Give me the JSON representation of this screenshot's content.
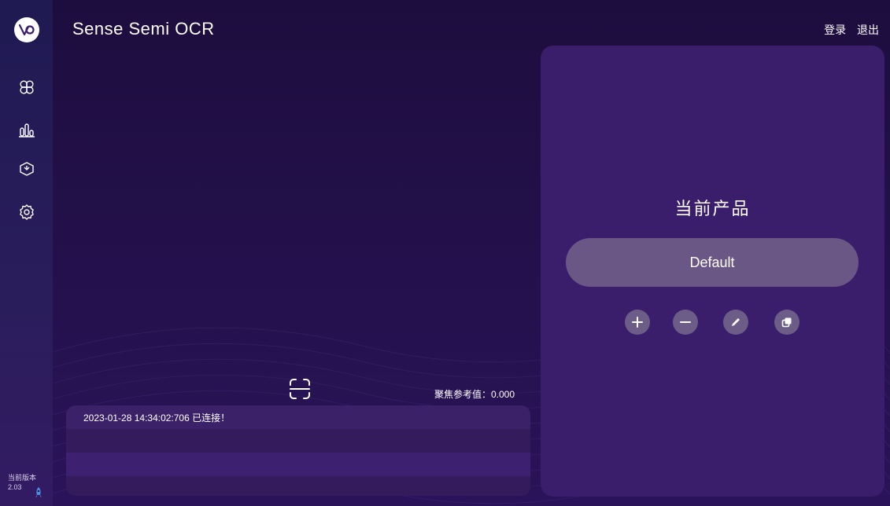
{
  "app": {
    "title": "Sense Semi OCR"
  },
  "header": {
    "login_label": "登录",
    "logout_label": "退出"
  },
  "sidebar": {
    "items": [
      {
        "name": "home",
        "icon": "grid-icon"
      },
      {
        "name": "statistics",
        "icon": "bar-chart-icon"
      },
      {
        "name": "product",
        "icon": "box-icon"
      },
      {
        "name": "settings",
        "icon": "gear-icon"
      }
    ],
    "version_label": "当前版本",
    "version_value": "2.03"
  },
  "main": {
    "focus_label": "聚焦参考值：0.000",
    "log": {
      "entries": [
        "2023-01-28 14:34:02:706  已连接！",
        "",
        "",
        ""
      ]
    }
  },
  "product_panel": {
    "title": "当前产品",
    "current_product": "Default",
    "actions": [
      "add",
      "remove",
      "edit",
      "copy"
    ]
  },
  "colors": {
    "background": "#1d0d3e",
    "sidebar": "#1f1a52",
    "panel": "#3a1d6b",
    "button": "#6a5785",
    "icon_button": "#6c5d88",
    "accent": "#4a90e2"
  }
}
